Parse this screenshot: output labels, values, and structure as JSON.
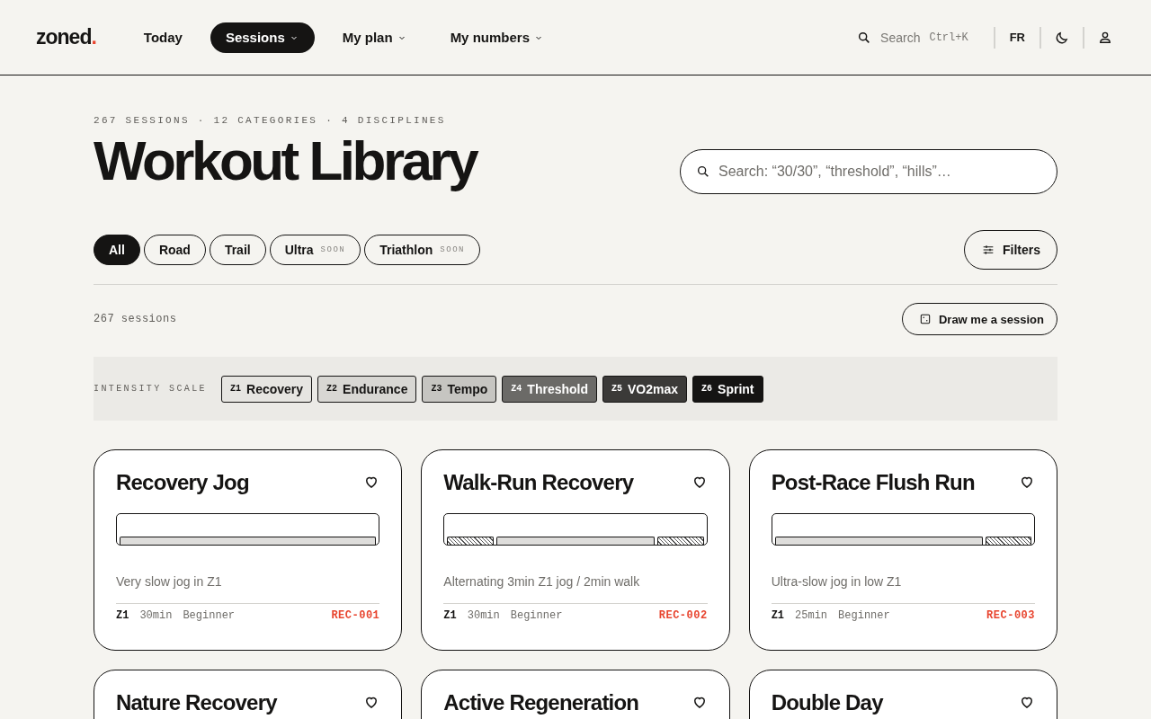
{
  "header": {
    "logo": "zoned",
    "logo_dot": ".",
    "nav": [
      {
        "label": "Today",
        "selected": false,
        "has_menu": false
      },
      {
        "label": "Sessions",
        "selected": true,
        "has_menu": true
      },
      {
        "label": "My plan",
        "selected": false,
        "has_menu": true
      },
      {
        "label": "My numbers",
        "selected": false,
        "has_menu": true
      }
    ],
    "search": {
      "placeholder": "Search",
      "shortcut": "Ctrl+K"
    },
    "language": "FR"
  },
  "hero": {
    "stats": "267 SESSIONS · 12 CATEGORIES · 4 DISCIPLINES",
    "title": "Workout Library",
    "search": {
      "placeholder": "Search: “30/30”, “threshold”, “hills”…"
    }
  },
  "disciplines": [
    {
      "label": "All",
      "selected": true
    },
    {
      "label": "Road",
      "selected": false
    },
    {
      "label": "Trail",
      "selected": false
    },
    {
      "label": "Ultra",
      "selected": false,
      "badge": "SOON"
    },
    {
      "label": "Triathlon",
      "selected": false,
      "badge": "SOON"
    }
  ],
  "filters_button": "Filters",
  "count": "267 sessions",
  "random_button": "Draw me a session",
  "intensity_scale": {
    "label": "INTENSITY SCALE",
    "zones": [
      {
        "code": "Z1",
        "name": "Recovery",
        "color": "#e6e5e1"
      },
      {
        "code": "Z2",
        "name": "Endurance",
        "color": "#d8d7d3"
      },
      {
        "code": "Z3",
        "name": "Tempo",
        "color": "#c6c5c1"
      },
      {
        "code": "Z4",
        "name": "Threshold",
        "color": "#6b6a67"
      },
      {
        "code": "Z5",
        "name": "VO2max",
        "color": "#3b3a38"
      },
      {
        "code": "Z6",
        "name": "Sprint",
        "color": "#151413"
      }
    ]
  },
  "cards": [
    {
      "title": "Recovery Jog",
      "segments": [
        {
          "kind": "main"
        }
      ],
      "description": "Very slow jog in Z1",
      "zone": "Z1",
      "duration": "30min",
      "level_label": "Beginner",
      "code": "REC-001"
    },
    {
      "title": "Walk-Run Recovery",
      "segments": [
        {
          "kind": "walk"
        },
        {
          "kind": "main"
        },
        {
          "kind": "walk"
        }
      ],
      "description": "Alternating 3min Z1 jog / 2min walk",
      "zone": "Z1",
      "duration": "30min",
      "level_label": "Beginner",
      "code": "REC-002"
    },
    {
      "title": "Post-Race Flush Run",
      "segments": [
        {
          "kind": "main"
        },
        {
          "kind": "walk"
        }
      ],
      "description": "Ultra-slow jog in low Z1",
      "zone": "Z1",
      "duration": "25min",
      "level_label": "Beginner",
      "code": "REC-003"
    },
    {
      "title": "Nature Recovery"
    },
    {
      "title": "Active Regeneration"
    },
    {
      "title": "Double Day"
    }
  ]
}
